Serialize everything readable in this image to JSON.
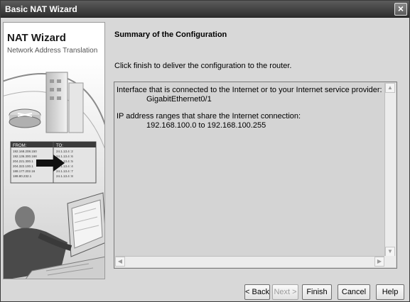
{
  "window": {
    "title": "Basic NAT Wizard"
  },
  "side": {
    "title": "NAT Wizard",
    "subtitle": "Network Address Translation",
    "graphic": {
      "table_headers": [
        "FROM:",
        "TO:"
      ],
      "table_rows": [
        [
          "192.168.208.150",
          "24.1.13.4 :2"
        ],
        [
          "192.136.300.168",
          "24.1.13.4 :6"
        ],
        [
          "204.221.300.1",
          "24.1.13.4 :5"
        ],
        [
          "204.322.100.1",
          "24.1.13.4 :4"
        ],
        [
          "188.177.202.16",
          "24.1.13.4 :7"
        ],
        [
          "188.80.232.1",
          "24.1.13.4 :8"
        ]
      ]
    }
  },
  "content": {
    "heading": "Summary of the Configuration",
    "intro": "Click finish to deliver the configuration to the router.",
    "summary": {
      "line1": "Interface that is connected to the Internet or to your Internet service provider:",
      "line2": "GigabitEthernet0/1",
      "line3": "IP address ranges that share the Internet connection:",
      "line4": "192.168.100.0 to 192.168.100.255"
    }
  },
  "buttons": {
    "back": "< Back",
    "next": "Next >",
    "finish": "Finish",
    "cancel": "Cancel",
    "help": "Help"
  }
}
